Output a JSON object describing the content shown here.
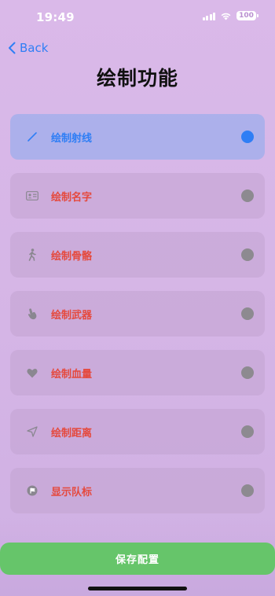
{
  "status_bar": {
    "time": "19:49",
    "battery": "100"
  },
  "nav": {
    "back_label": "Back",
    "title": "绘制功能"
  },
  "items": [
    {
      "label": "绘制射线",
      "icon": "pencil-icon",
      "selected": true
    },
    {
      "label": "绘制名字",
      "icon": "id-card-icon",
      "selected": false
    },
    {
      "label": "绘制骨骼",
      "icon": "walking-figure-icon",
      "selected": false
    },
    {
      "label": "绘制武器",
      "icon": "hand-pointer-icon",
      "selected": false
    },
    {
      "label": "绘制血量",
      "icon": "heart-icon",
      "selected": false
    },
    {
      "label": "绘制距离",
      "icon": "location-arrow-icon",
      "selected": false
    },
    {
      "label": "显示队标",
      "icon": "flag-icon",
      "selected": false
    }
  ],
  "footer": {
    "save_label": "保存配置"
  },
  "colors": {
    "accent_blue": "#2f7ef5",
    "label_red": "#e5493d",
    "save_green": "#66c56a",
    "radio_gray": "#8d8a90"
  }
}
